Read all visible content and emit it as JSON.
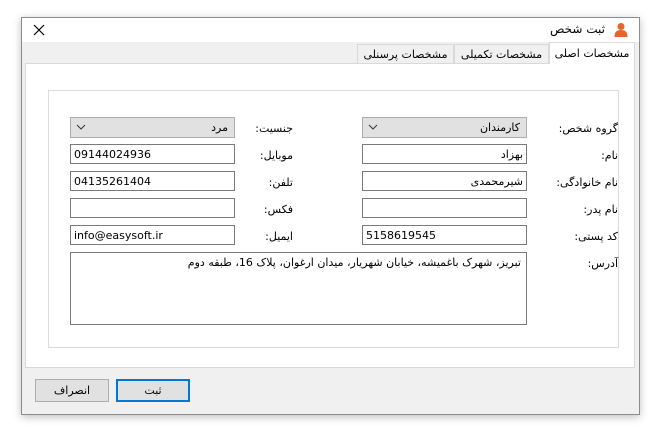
{
  "window": {
    "title": "ثبت شخص",
    "close_icon": "close-icon",
    "app_icon": "person-icon"
  },
  "tabs": [
    {
      "label": "مشخصات اصلی",
      "active": true
    },
    {
      "label": "مشخصات تکمیلی",
      "active": false
    },
    {
      "label": "مشخصات پرسنلی",
      "active": false
    }
  ],
  "form": {
    "group_label": "گروه شخص:",
    "group_value": "کارمندان",
    "gender_label": "جنسیت:",
    "gender_value": "مرد",
    "first_name_label": "نام:",
    "first_name_value": "بهزاد",
    "mobile_label": "موبایل:",
    "mobile_value": "09144024936",
    "last_name_label": "نام خانوادگی:",
    "last_name_value": "شیرمحمدی",
    "phone_label": "تلفن:",
    "phone_value": "04135261404",
    "father_label": "نام پدر:",
    "father_value": "",
    "fax_label": "فکس:",
    "fax_value": "",
    "postal_label": "کد پستی:",
    "postal_value": "5158619545",
    "email_label": "ایمیل:",
    "email_value": "info@easysoft.ir",
    "address_label": "آدرس:",
    "address_value": "تبریز، شهرک باغمیشه، خیابان شهریار، میدان ارغوان، پلاک 16، طبقه دوم"
  },
  "buttons": {
    "submit": "ثبت",
    "cancel": "انصراف"
  },
  "colors": {
    "accent": "#0078d7",
    "icon": "#e8642c"
  }
}
